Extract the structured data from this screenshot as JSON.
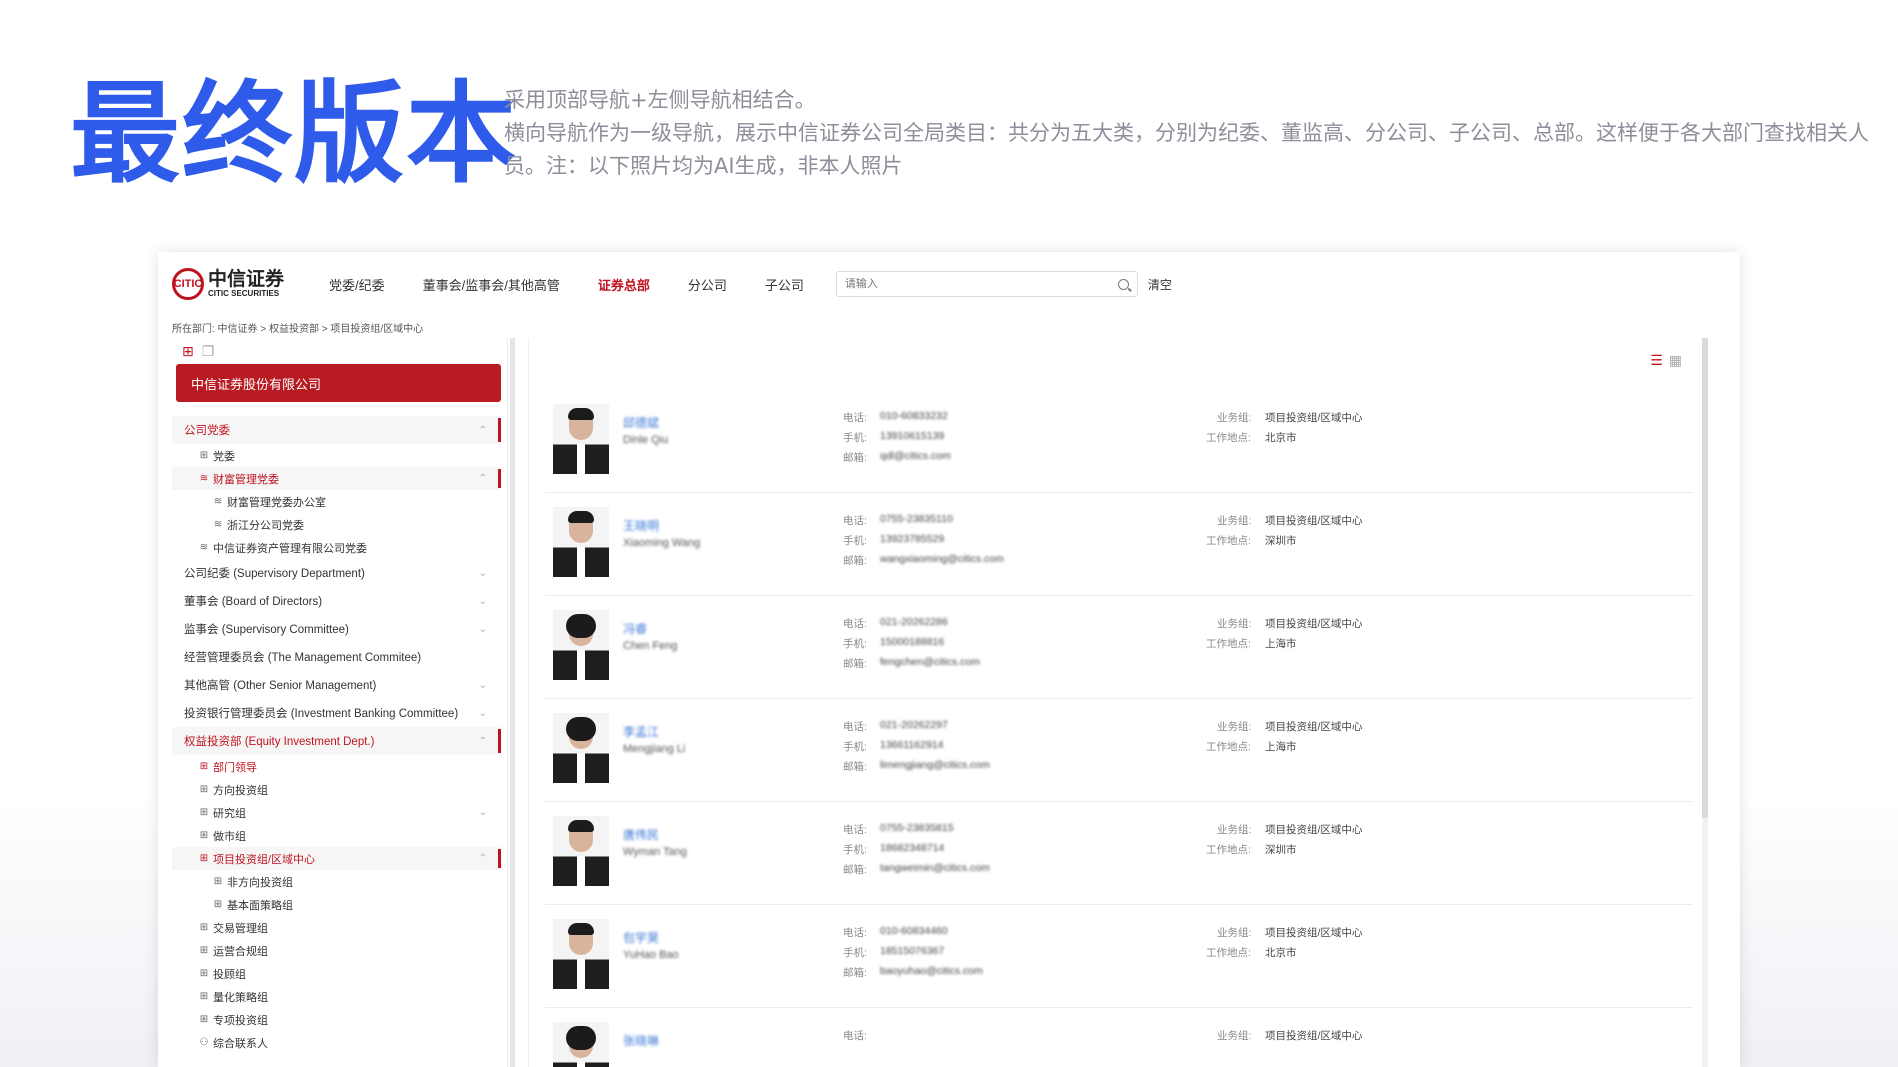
{
  "headline": "最终版本",
  "description": [
    "采用顶部导航+左侧导航相结合。",
    "横向导航作为一级导航，展示中信证券公司全局类目：共分为五大类，分别为纪委、董监高、分公司、子公司、总部。这样便于各大部门查找相关人员。注：以下照片均为AI生成，非本人照片"
  ],
  "logo": {
    "cn": "中信证券",
    "en": "CITIC SECURITIES",
    "mark": "CITIC"
  },
  "nav": [
    "党委/纪委",
    "董事会/监事会/其他高管",
    "证券总部",
    "分公司",
    "子公司"
  ],
  "nav_active": "证券总部",
  "search": {
    "placeholder": "请输入",
    "clear": "清空"
  },
  "breadcrumb": "所在部门:  中信证券 > 权益投资部 > 项目投资组/区域中心",
  "sidebar": {
    "company": "中信证券股份有限公司",
    "tree": [
      {
        "label": "公司党委",
        "level": 0,
        "state": "active-section",
        "chev": "⌃"
      },
      {
        "label": "党委",
        "level": 1,
        "icon": "group"
      },
      {
        "label": "财富管理党委",
        "level": 1,
        "icon": "layers",
        "state": "active",
        "chev": "⌃"
      },
      {
        "label": "财富管理党委办公室",
        "level": 2,
        "icon": "layers"
      },
      {
        "label": "浙江分公司党委",
        "level": 2,
        "icon": "layers"
      },
      {
        "label": "中信证券资产管理有限公司党委",
        "level": 1,
        "icon": "layers"
      },
      {
        "label": "公司纪委 (Supervisory Department)",
        "level": 0,
        "chev": "⌄"
      },
      {
        "label": "董事会 (Board of Directors)",
        "level": 0,
        "chev": "⌄"
      },
      {
        "label": "监事会 (Supervisory Committee)",
        "level": 0,
        "chev": "⌄"
      },
      {
        "label": "经营管理委员会 (The Management Commitee)",
        "level": 0
      },
      {
        "label": "其他高管 (Other Senior Management)",
        "level": 0,
        "chev": "⌄"
      },
      {
        "label": "投资银行管理委员会 (Investment Banking Committee)",
        "level": 0,
        "chev": "⌄"
      },
      {
        "label": "权益投资部 (Equity Investment Dept.)",
        "level": 0,
        "state": "active-section",
        "chev": "⌃"
      },
      {
        "label": "部门领导",
        "level": 1,
        "icon": "group",
        "state": "active"
      },
      {
        "label": "方向投资组",
        "level": 1,
        "icon": "group"
      },
      {
        "label": "研究组",
        "level": 1,
        "icon": "group",
        "chev": "⌄"
      },
      {
        "label": "做市组",
        "level": 1,
        "icon": "group"
      },
      {
        "label": "项目投资组/区域中心",
        "level": 1,
        "icon": "group",
        "state": "active",
        "chev": "⌃"
      },
      {
        "label": "非方向投资组",
        "level": 2,
        "icon": "group"
      },
      {
        "label": "基本面策略组",
        "level": 2,
        "icon": "group"
      },
      {
        "label": "交易管理组",
        "level": 1,
        "icon": "group"
      },
      {
        "label": "运营合规组",
        "level": 1,
        "icon": "group"
      },
      {
        "label": "投顾组",
        "level": 1,
        "icon": "group"
      },
      {
        "label": "量化策略组",
        "level": 1,
        "icon": "group"
      },
      {
        "label": "专项投资组",
        "level": 1,
        "icon": "group"
      },
      {
        "label": "综合联系人",
        "level": 1,
        "icon": "person"
      }
    ]
  },
  "labels": {
    "phone": "电话:",
    "mobile": "手机:",
    "email": "邮箱:",
    "group": "业务组:",
    "location": "工作地点:"
  },
  "people": [
    {
      "name": "邱德斌",
      "ename": "Dinle Qiu",
      "phone": "010-60833232",
      "mobile": "13910615139",
      "email": "qdl@citics.com",
      "group": "项目投资组/区域中心",
      "location": "北京市",
      "gender": "m"
    },
    {
      "name": "王晓明",
      "ename": "Xiaoming Wang",
      "phone": "0755-23835110",
      "mobile": "13923785529",
      "email": "wangxiaoming@citics.com",
      "group": "项目投资组/区域中心",
      "location": "深圳市",
      "gender": "m"
    },
    {
      "name": "冯睿",
      "ename": "Chen Feng",
      "phone": "021-20262286",
      "mobile": "15000188816",
      "email": "fengchen@citics.com",
      "group": "项目投资组/区域中心",
      "location": "上海市",
      "gender": "f"
    },
    {
      "name": "李孟江",
      "ename": "Mengjiang Li",
      "phone": "021-20262297",
      "mobile": "13661162914",
      "email": "limengjiang@citics.com",
      "group": "项目投资组/区域中心",
      "location": "上海市",
      "gender": "f"
    },
    {
      "name": "唐伟民",
      "ename": "Wyman Tang",
      "phone": "0755-23835815",
      "mobile": "18682348714",
      "email": "tangweimin@citics.com",
      "group": "项目投资组/区域中心",
      "location": "深圳市",
      "gender": "m"
    },
    {
      "name": "包宇昊",
      "ename": "YuHao Bao",
      "phone": "010-60834460",
      "mobile": "18515076367",
      "email": "baoyuhao@citics.com",
      "group": "项目投资组/区域中心",
      "location": "北京市",
      "gender": "m"
    },
    {
      "name": "张晓琳",
      "ename": "",
      "phone": "",
      "mobile": "",
      "email": "",
      "group": "项目投资组/区域中心",
      "location": "",
      "gender": "f"
    }
  ]
}
